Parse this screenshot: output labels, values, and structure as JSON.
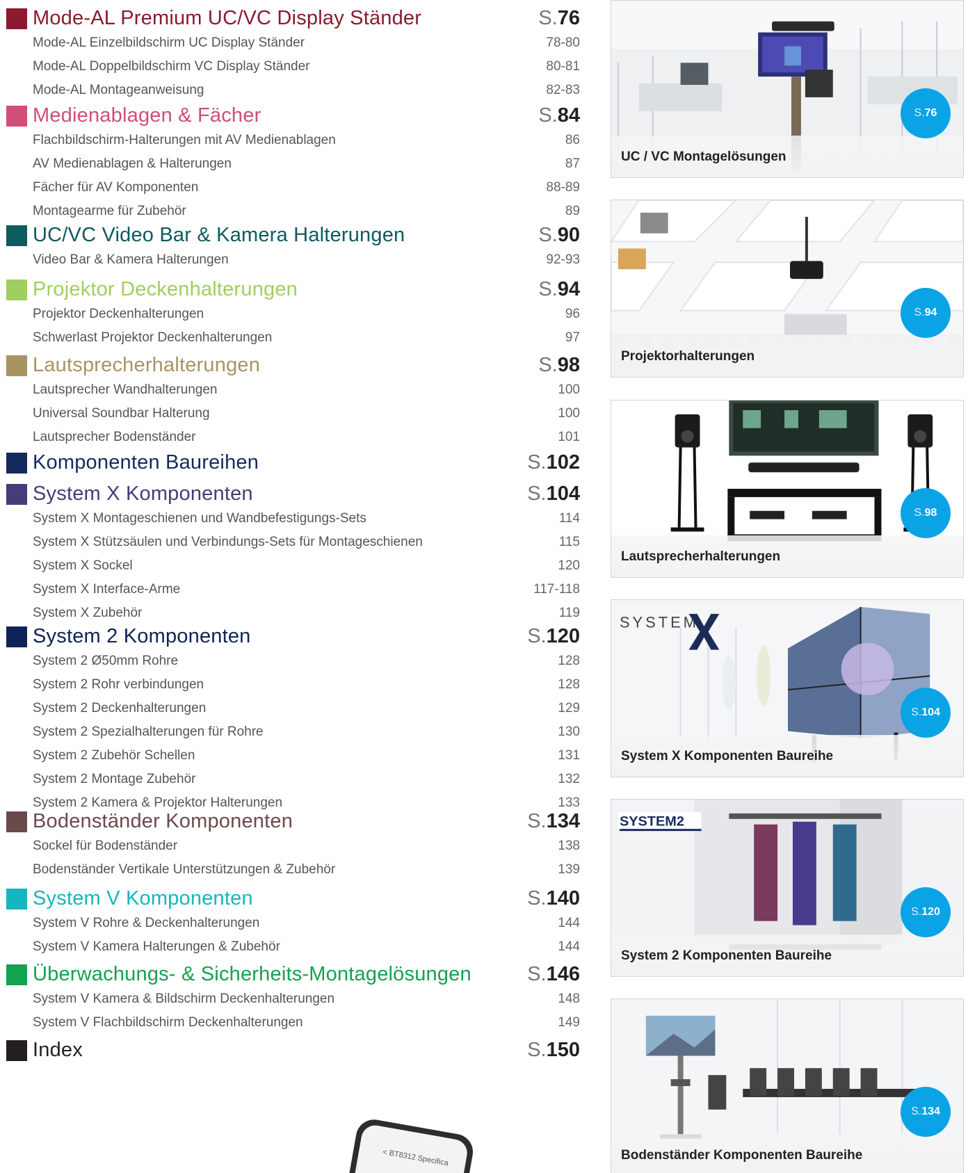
{
  "toc": [
    {
      "title": "Mode-AL Premium UC/VC Display Ständer",
      "page_prefix": "S.",
      "page": "76",
      "color": "#8b1a2e",
      "items": [
        {
          "label": "Mode-AL Einzelbildschirm UC Display Ständer",
          "page": "78-80"
        },
        {
          "label": "Mode-AL Doppelbildschirm VC Display Ständer",
          "page": "80-81"
        },
        {
          "label": "Mode-AL Montageanweisung",
          "page": "82-83"
        }
      ]
    },
    {
      "title": "Medienablagen & Fächer",
      "page_prefix": "S.",
      "page": "84",
      "color": "#cf4f76",
      "items": [
        {
          "label": "Flachbildschirm-Halterungen mit AV Medienablagen",
          "page": "86"
        },
        {
          "label": "AV Medienablagen & Halterungen",
          "page": "87"
        },
        {
          "label": "Fächer für AV Komponenten",
          "page": "88-89"
        },
        {
          "label": "Montagearme für Zubehör",
          "page": "89"
        }
      ]
    },
    {
      "title": "UC/VC Video Bar & Kamera Halterungen",
      "page_prefix": "S.",
      "page": "90",
      "color": "#0d5a5f",
      "items": [
        {
          "label": "Video Bar & Kamera Halterungen",
          "page": "92-93"
        }
      ]
    },
    {
      "title": "Projektor Deckenhalterungen",
      "page_prefix": "S.",
      "page": "94",
      "color": "#9fcf5f",
      "items": [
        {
          "label": "Projektor Deckenhalterungen",
          "page": "96"
        },
        {
          "label": "Schwerlast Projektor Deckenhalterungen",
          "page": "97"
        }
      ]
    },
    {
      "title": "Lautsprecherhalterungen",
      "page_prefix": "S.",
      "page": "98",
      "color": "#a89461",
      "items": [
        {
          "label": "Lautsprecher Wandhalterungen",
          "page": "100"
        },
        {
          "label": "Universal Soundbar Halterung",
          "page": "100"
        },
        {
          "label": "Lautsprecher Bodenständer",
          "page": "101"
        }
      ]
    },
    {
      "title": "Komponenten Baureihen",
      "page_prefix": "S.",
      "page": "102",
      "color": "#152a5c",
      "items": []
    },
    {
      "title": "System X Komponenten",
      "page_prefix": "S.",
      "page": "104",
      "color": "#433d7a",
      "items": [
        {
          "label": "System X Montageschienen und Wandbefestigungs-Sets",
          "page": "114"
        },
        {
          "label": "System X Stützsäulen und Verbindungs-Sets für Montageschienen",
          "page": "115"
        },
        {
          "label": "System X Sockel",
          "page": "120"
        },
        {
          "label": "System X Interface-Arme",
          "page": "117-118"
        },
        {
          "label": "System X Zubehör",
          "page": "119"
        }
      ]
    },
    {
      "title": "System 2 Komponenten",
      "page_prefix": "S.",
      "page": "120",
      "color": "#0e2356",
      "items": [
        {
          "label": "System 2 Ø50mm Rohre",
          "page": "128"
        },
        {
          "label": "System 2 Rohr verbindungen",
          "page": "128"
        },
        {
          "label": "System 2 Deckenhalterungen",
          "page": "129"
        },
        {
          "label": "System 2 Spezialhalterungen für Rohre",
          "page": "130"
        },
        {
          "label": "System 2 Zubehör Schellen",
          "page": "131"
        },
        {
          "label": "System 2 Montage Zubehör",
          "page": "132"
        },
        {
          "label": "System 2 Kamera & Projektor Halterungen",
          "page": "133"
        }
      ]
    },
    {
      "title": "Bodenständer Komponenten",
      "page_prefix": "S.",
      "page": "134",
      "color": "#6b4a4c",
      "items": [
        {
          "label": "Sockel für Bodenständer",
          "page": "138"
        },
        {
          "label": "Bodenständer Vertikale Unterstützungen & Zubehör",
          "page": "139"
        }
      ]
    },
    {
      "title": "System V Komponenten",
      "page_prefix": "S.",
      "page": "140",
      "color": "#15b6c0",
      "items": [
        {
          "label": "System V Rohre & Deckenhalterungen",
          "page": "144"
        },
        {
          "label": "System V Kamera Halterungen & Zubehör",
          "page": "144"
        }
      ]
    },
    {
      "title": "Überwachungs- & Sicherheits-Montagelösungen",
      "page_prefix": "S.",
      "page": "146",
      "color": "#14a24e",
      "items": [
        {
          "label": "System V Kamera & Bildschirm Deckenhalterungen",
          "page": "148"
        },
        {
          "label": "System V Flachbildschirm Deckenhalterungen",
          "page": "149"
        }
      ]
    },
    {
      "title": "Index",
      "page_prefix": "S.",
      "page": "150",
      "color": "#231f20",
      "items": []
    }
  ],
  "cards": [
    {
      "caption": "UC / VC Montagelösungen",
      "badge_prefix": "S.",
      "badge_page": "76",
      "scene": "office-display-stand"
    },
    {
      "caption": "Projektorhalterungen",
      "badge_prefix": "S.",
      "badge_page": "94",
      "scene": "ceiling-projector"
    },
    {
      "caption": "Lautsprecherhalterungen",
      "badge_prefix": "S.",
      "badge_page": "98",
      "scene": "speaker-stands"
    },
    {
      "caption": "System X Komponenten Baureihe",
      "badge_prefix": "S.",
      "badge_page": "104",
      "scene": "video-wall",
      "logo_text": "SYSTEM"
    },
    {
      "caption": "System 2 Komponenten Baureihe",
      "badge_prefix": "S.",
      "badge_page": "120",
      "scene": "portrait-displays"
    },
    {
      "caption": "Bodenständer Komponenten Baureihe",
      "badge_prefix": "S.",
      "badge_page": "134",
      "scene": "floor-stand"
    }
  ],
  "phone": {
    "screen_text": "< BT8312 Specifica"
  },
  "colors": {
    "badge": "#0aa3e6"
  }
}
